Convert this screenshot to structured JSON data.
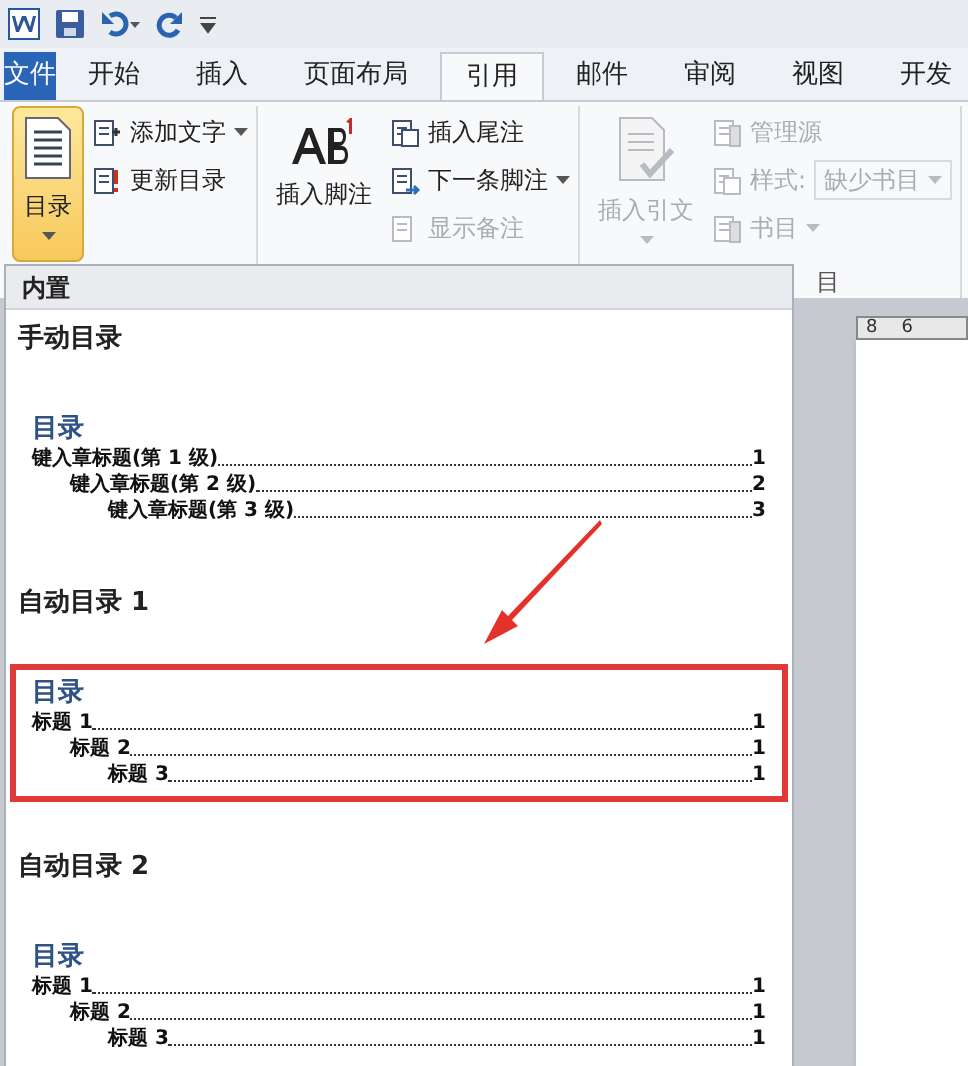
{
  "tabs": [
    {
      "label": "文件",
      "kind": "file",
      "selected": false
    },
    {
      "label": "开始",
      "kind": "tab",
      "selected": false
    },
    {
      "label": "插入",
      "kind": "tab",
      "selected": false
    },
    {
      "label": "页面布局",
      "kind": "tab",
      "selected": false
    },
    {
      "label": "引用",
      "kind": "tab",
      "selected": true
    },
    {
      "label": "邮件",
      "kind": "tab",
      "selected": false
    },
    {
      "label": "审阅",
      "kind": "tab",
      "selected": false
    },
    {
      "label": "视图",
      "kind": "tab",
      "selected": false
    },
    {
      "label": "开发",
      "kind": "tab",
      "selected": false
    }
  ],
  "ribbon": {
    "groups": [
      {
        "big": {
          "label": "目录",
          "expanded": true,
          "disabled": false,
          "dropdown": true
        },
        "small": [
          {
            "label": "添加文字",
            "dropdown": true,
            "disabled": false
          },
          {
            "label": "更新目录",
            "dropdown": false,
            "disabled": false
          }
        ]
      },
      {
        "big": {
          "label": "插入脚注",
          "expanded": false,
          "disabled": false,
          "dropdown": false
        },
        "small": [
          {
            "label": "插入尾注",
            "dropdown": false,
            "disabled": false
          },
          {
            "label": "下一条脚注",
            "dropdown": true,
            "disabled": false
          },
          {
            "label": "显示备注",
            "dropdown": false,
            "disabled": true
          }
        ]
      },
      {
        "big": {
          "label": "插入引文",
          "expanded": false,
          "disabled": true,
          "dropdown": true
        },
        "small": [
          {
            "label": "管理源",
            "dropdown": false,
            "disabled": true
          },
          {
            "label": "样式:",
            "select": "缺少书目",
            "dropdown": true,
            "disabled": true
          },
          {
            "label": "书目",
            "dropdown": true,
            "disabled": true
          }
        ],
        "group_label": "目"
      }
    ]
  },
  "ruler": [
    "8",
    "6"
  ],
  "toc_menu": {
    "header": "内置",
    "items": [
      {
        "title": "手动目录",
        "highlighted": false,
        "preview": {
          "heading": "目录",
          "entries": [
            {
              "text": "键入章标题(第 1 级)",
              "page": "1",
              "children": [
                {
                  "text": "键入章标题(第 2 级)",
                  "page": "2",
                  "children": [
                    {
                      "text": "键入章标题(第 3 级)",
                      "page": "3"
                    }
                  ]
                }
              ]
            }
          ]
        }
      },
      {
        "title": "自动目录 1",
        "highlighted": true,
        "preview": {
          "heading": "目录",
          "entries": [
            {
              "text": "标题 1",
              "page": "1",
              "children": [
                {
                  "text": "标题 2",
                  "page": "1",
                  "children": [
                    {
                      "text": "标题 3",
                      "page": "1"
                    }
                  ]
                }
              ]
            }
          ]
        }
      },
      {
        "title": "自动目录 2",
        "highlighted": false,
        "preview": {
          "heading": "目录",
          "entries": [
            {
              "text": "标题 1",
              "page": "1",
              "children": [
                {
                  "text": "标题 2",
                  "page": "1",
                  "children": [
                    {
                      "text": "标题 3",
                      "page": "1"
                    }
                  ]
                }
              ]
            }
          ]
        }
      }
    ]
  }
}
